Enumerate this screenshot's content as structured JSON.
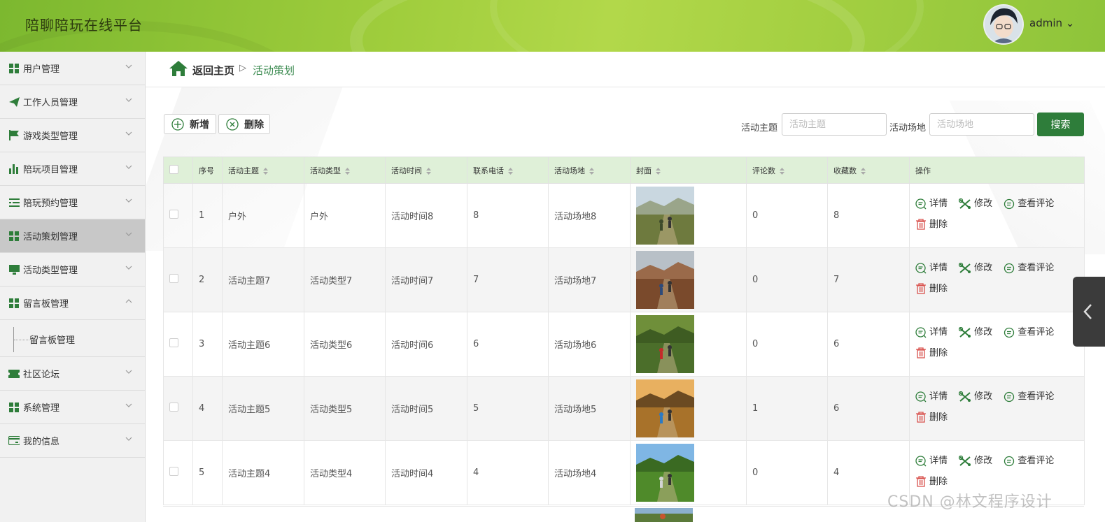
{
  "header": {
    "title": "陪聊陪玩在线平台",
    "user": "admin ⌄"
  },
  "sidebar": {
    "items": [
      {
        "label": "用户管理",
        "icon": "grid-icon"
      },
      {
        "label": "工作人员管理",
        "icon": "paper-plane-icon"
      },
      {
        "label": "游戏类型管理",
        "icon": "flag-icon"
      },
      {
        "label": "陪玩项目管理",
        "icon": "bar-chart-icon"
      },
      {
        "label": "陪玩预约管理",
        "icon": "list-icon"
      },
      {
        "label": "活动策划管理",
        "icon": "grid-icon"
      },
      {
        "label": "活动类型管理",
        "icon": "monitor-icon"
      },
      {
        "label": "留言板管理",
        "icon": "grid-icon"
      },
      {
        "label": "社区论坛",
        "icon": "ticket-icon"
      },
      {
        "label": "系统管理",
        "icon": "grid-icon"
      },
      {
        "label": "我的信息",
        "icon": "card-icon"
      }
    ],
    "sub_item": "留言板管理"
  },
  "breadcrumb": {
    "home": "返回主页",
    "separator": "▷",
    "current": "活动策划"
  },
  "toolbar": {
    "add_label": "新增",
    "delete_label": "删除",
    "topic_label": "活动主题",
    "topic_placeholder": "活动主题",
    "venue_label": "活动场地",
    "venue_placeholder": "活动场地",
    "search_label": "搜索"
  },
  "table": {
    "columns": [
      "序号",
      "活动主题",
      "活动类型",
      "活动时间",
      "联系电话",
      "活动场地",
      "封面",
      "评论数",
      "收藏数",
      "操作"
    ],
    "rows": [
      {
        "no": "1",
        "topic": "户外",
        "type": "户外",
        "time": "活动时间8",
        "phone": "8",
        "venue": "活动场地8",
        "comments": "0",
        "favorites": "8"
      },
      {
        "no": "2",
        "topic": "活动主题7",
        "type": "活动类型7",
        "time": "活动时间7",
        "phone": "7",
        "venue": "活动场地7",
        "comments": "0",
        "favorites": "7"
      },
      {
        "no": "3",
        "topic": "活动主题6",
        "type": "活动类型6",
        "time": "活动时间6",
        "phone": "6",
        "venue": "活动场地6",
        "comments": "0",
        "favorites": "6"
      },
      {
        "no": "4",
        "topic": "活动主题5",
        "type": "活动类型5",
        "time": "活动时间5",
        "phone": "5",
        "venue": "活动场地5",
        "comments": "1",
        "favorites": "6"
      },
      {
        "no": "5",
        "topic": "活动主题4",
        "type": "活动类型4",
        "time": "活动时间4",
        "phone": "4",
        "venue": "活动场地4",
        "comments": "0",
        "favorites": "4"
      }
    ],
    "actions": {
      "detail": "详情",
      "edit": "修改",
      "comments": "查看评论",
      "delete": "删除"
    }
  },
  "watermark": "CSDN @林文程序设计",
  "colors": {
    "accent": "#2e7d3a",
    "header": "#9fcd3c",
    "table_header": "#dff0d8"
  }
}
